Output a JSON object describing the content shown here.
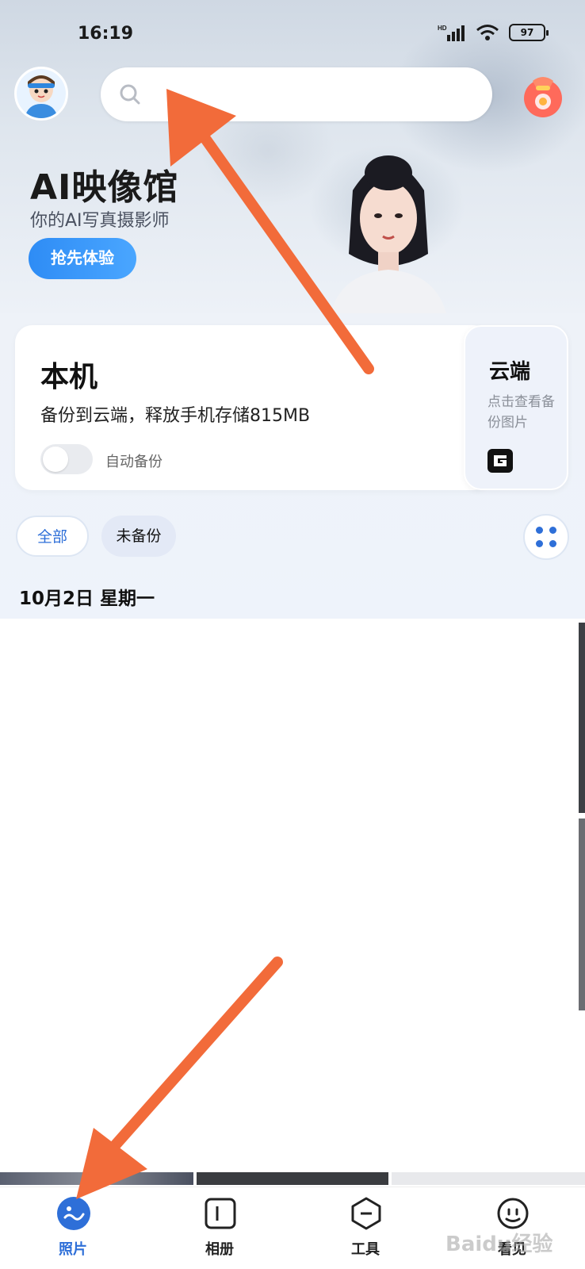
{
  "status_bar": {
    "time": "16:19",
    "battery": "97",
    "network": "HD"
  },
  "header": {
    "search_placeholder": ""
  },
  "banner": {
    "title": "AI映像馆",
    "subtitle": "你的AI写真摄影师",
    "cta_label": "抢先体验"
  },
  "local_card": {
    "title": "本机",
    "description": "备份到云端，释放手机存储815MB",
    "auto_backup_label": "自动备份",
    "auto_backup_on": false
  },
  "cloud_card": {
    "title": "云端",
    "description": "点击查看备份图片"
  },
  "filters": {
    "all_label": "全部",
    "unbacked_label": "未备份"
  },
  "date_heading": "10月2日 星期一",
  "bottom_nav": [
    {
      "label": "照片",
      "icon": "photos-icon",
      "active": true
    },
    {
      "label": "相册",
      "icon": "album-icon",
      "active": false
    },
    {
      "label": "工具",
      "icon": "tools-icon",
      "active": false
    },
    {
      "label": "看见",
      "icon": "see-icon",
      "active": false
    }
  ],
  "watermark": "Baidu经验",
  "colors": {
    "accent": "#2e6fd8",
    "arrow": "#f26b3a",
    "cta": "#2e8cf5"
  }
}
